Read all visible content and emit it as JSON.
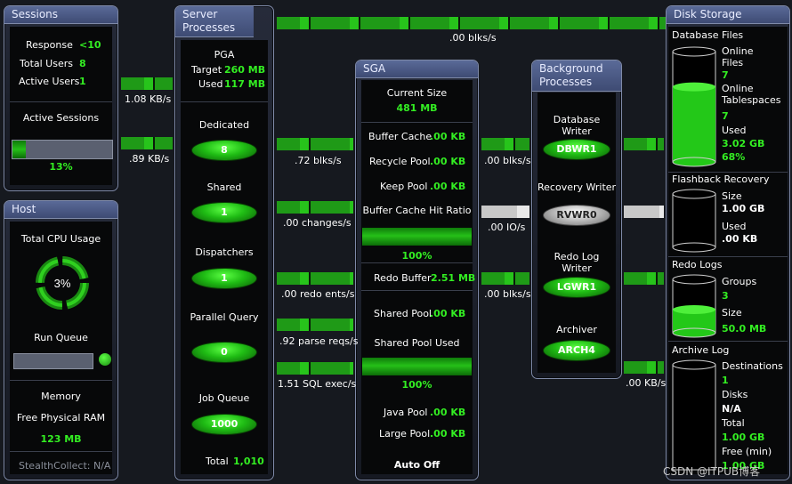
{
  "sessions": {
    "title": "Sessions",
    "response_label": "Response",
    "response_value": "<10",
    "total_users_label": "Total Users",
    "total_users_value": "8",
    "active_users_label": "Active Users",
    "active_users_value": "1",
    "active_sessions_label": "Active Sessions",
    "active_sessions_pct": "13%",
    "active_sessions_fraction": 0.13
  },
  "host": {
    "title": "Host",
    "cpu_label": "Total CPU Usage",
    "cpu_value": "3%",
    "run_queue_label": "Run Queue",
    "memory_label": "Memory",
    "free_ram_label": "Free Physical RAM",
    "free_ram_value": "123 MB",
    "stealth": "StealthCollect: N/A"
  },
  "server": {
    "title": "Server Processes",
    "pga_label": "PGA",
    "target_label": "Target",
    "target_value": "260 MB",
    "used_label": "Used",
    "used_value": "117 MB",
    "dedicated_label": "Dedicated",
    "dedicated_value": "8",
    "shared_label": "Shared",
    "shared_value": "1",
    "dispatchers_label": "Dispatchers",
    "dispatchers_value": "1",
    "parallel_label": "Parallel Query",
    "parallel_value": "0",
    "jobqueue_label": "Job Queue",
    "jobqueue_value": "1000",
    "total_label": "Total",
    "total_value": "1,010"
  },
  "sga": {
    "title": "SGA",
    "current_size_label": "Current Size",
    "current_size_value": "481 MB",
    "buffer_cache_label": "Buffer Cache",
    "buffer_cache_value": ".00 KB",
    "recycle_label": "Recycle Pool",
    "recycle_value": ".00 KB",
    "keep_label": "Keep Pool",
    "keep_value": ".00 KB",
    "hit_ratio_label": "Buffer Cache Hit Ratio",
    "hit_ratio_value": "100%",
    "hit_ratio_fraction": 1.0,
    "redo_label": "Redo Buffer",
    "redo_value": "2.51 MB",
    "shared_pool_label": "Shared Pool",
    "shared_pool_value": ".00 KB",
    "shared_used_label": "Shared Pool Used",
    "shared_used_value": "100%",
    "shared_used_fraction": 1.0,
    "java_label": "Java Pool",
    "java_value": ".00 KB",
    "large_label": "Large Pool",
    "large_value": ".00 KB",
    "auto_off": "Auto Off"
  },
  "background": {
    "title": "Background Processes",
    "dbw_label": "Database Writer",
    "dbw_value": "DBWR1",
    "rvw_label": "Recovery Writer",
    "rvw_value": "RVWR0",
    "lgw_label": "Redo Log Writer",
    "lgw_value": "LGWR1",
    "arch_label": "Archiver",
    "arch_value": "ARCH4"
  },
  "disk": {
    "title": "Disk Storage",
    "dbfiles_label": "Database Files",
    "online_files_label": "Online Files",
    "online_files_value": "7",
    "online_ts_label": "Online Tablespaces",
    "online_ts_value": "7",
    "used_label": "Used",
    "used_value": "3.02 GB",
    "used_pct": "68%",
    "used_fraction": 0.68,
    "flash_label": "Flashback Recovery",
    "flash_size_label": "Size",
    "flash_size_value": "1.00 GB",
    "flash_used_label": "Used",
    "flash_used_value": ".00 KB",
    "redo_label": "Redo Logs",
    "groups_label": "Groups",
    "groups_value": "3",
    "redo_size_label": "Size",
    "redo_size_value": "50.0 MB",
    "archive_label": "Archive Log",
    "dest_label": "Destinations",
    "dest_value": "1",
    "disks_label": "Disks",
    "disks_value": "N/A",
    "total_label": "Total",
    "total_value": "1.00 GB",
    "free_label": "Free (min)",
    "free_value": "1.00 GB"
  },
  "flows": {
    "top": ".00 blks/s",
    "sess_in": "1.08 KB/s",
    "sess_out": ".89 KB/s",
    "blks1": ".72 blks/s",
    "changes": ".00 changes/s",
    "redo_ents": ".00 redo ents/s",
    "parse": ".92 parse reqs/s",
    "sql": "1.51 SQL exec/s",
    "bg_blks": ".00 blks/s",
    "io": ".00 IO/s",
    "bg_blks2": ".00 blks/s",
    "archive_kb": ".00 KB/s"
  },
  "watermark": "CSDN @ITPUB博客"
}
